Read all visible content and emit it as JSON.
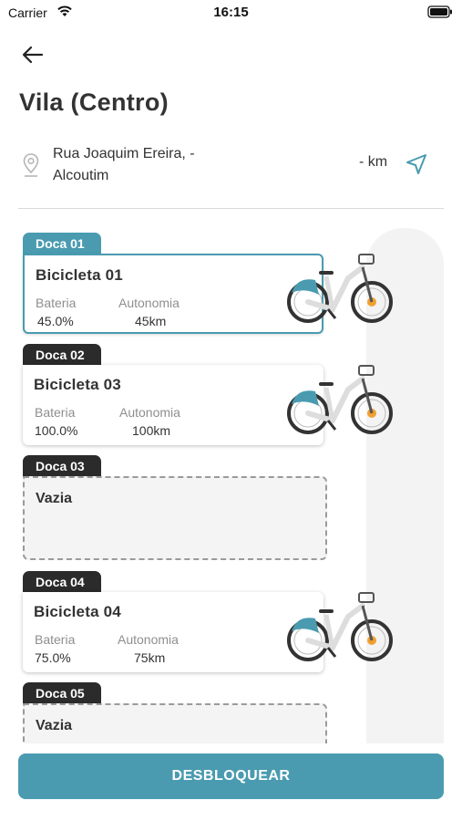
{
  "status_bar": {
    "carrier": "Carrier",
    "time": "16:15"
  },
  "header": {
    "title": "Vila (Centro)"
  },
  "address": {
    "line1": "Rua Joaquim Ereira, -",
    "line2": "Alcoutim",
    "distance": "- km"
  },
  "labels": {
    "battery": "Bateria",
    "autonomy": "Autonomia"
  },
  "docks": [
    {
      "tab": "Doca 01",
      "state": "active",
      "bike": "Bicicleta 01",
      "battery": "45.0%",
      "autonomy": "45km"
    },
    {
      "tab": "Doca 02",
      "state": "occupied",
      "bike": "Bicicleta 03",
      "battery": "100.0%",
      "autonomy": "100km"
    },
    {
      "tab": "Doca 03",
      "state": "empty",
      "empty_label": "Vazia"
    },
    {
      "tab": "Doca 04",
      "state": "occupied",
      "bike": "Bicicleta 04",
      "battery": "75.0%",
      "autonomy": "75km"
    },
    {
      "tab": "Doca 05",
      "state": "empty",
      "empty_label": "Vazia"
    }
  ],
  "actions": {
    "unlock": "DESBLOQUEAR"
  },
  "colors": {
    "accent": "#4a9bb0",
    "dark_tab": "#2b2b2b",
    "empty_bg": "#f4f4f4"
  }
}
